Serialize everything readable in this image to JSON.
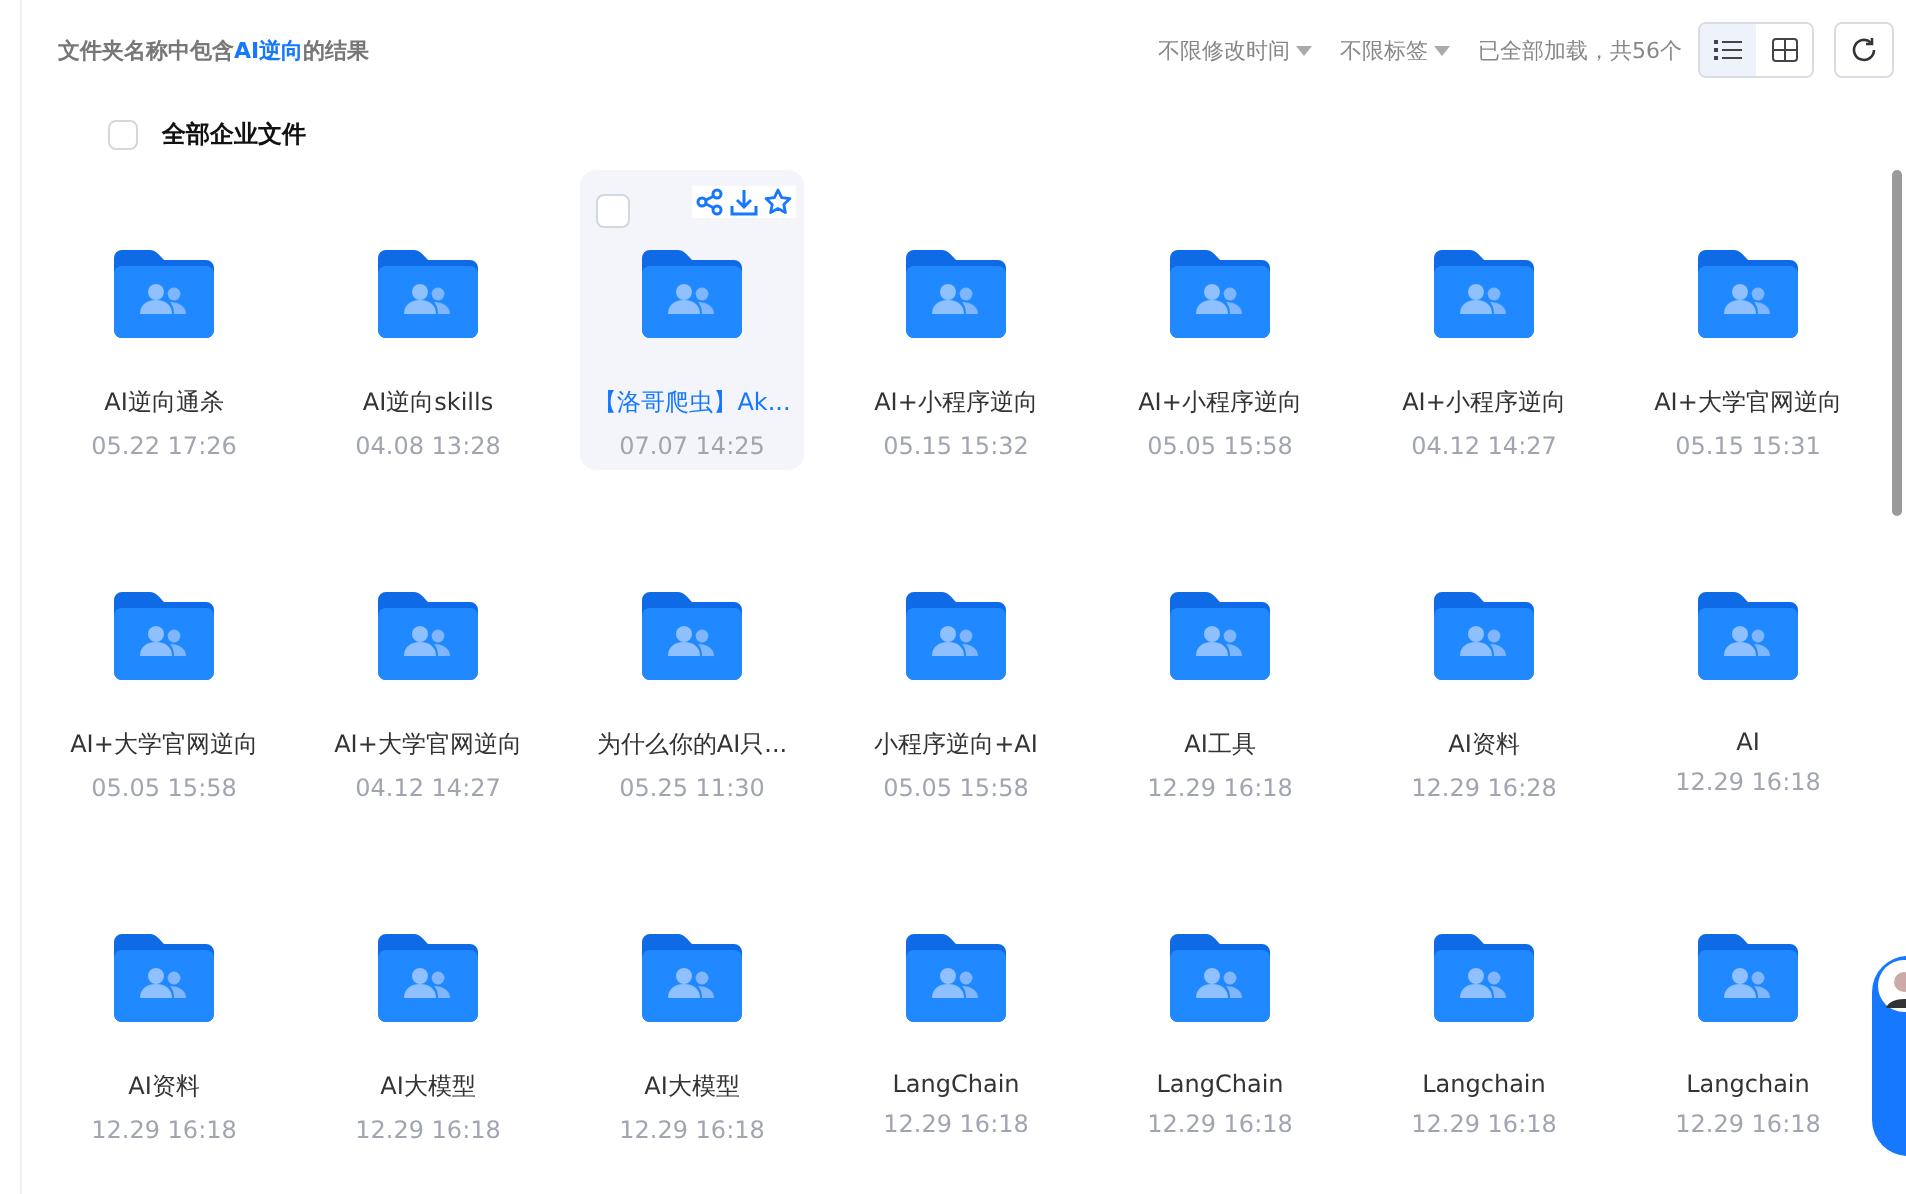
{
  "header": {
    "result_prefix": "文件夹名称中包含",
    "query": "AI逆向",
    "result_suffix": "的结果",
    "filters": [
      {
        "label": "不限修改时间"
      },
      {
        "label": "不限标签"
      }
    ],
    "status": "已全部加载，共56个",
    "views": [
      {
        "kind": "list",
        "selected": true
      },
      {
        "kind": "grid",
        "selected": false
      }
    ]
  },
  "select_all": {
    "label": "全部企业文件",
    "checked": false
  },
  "folders": [
    {
      "name": "AI逆向通杀",
      "time": "05.22 17:26",
      "hovered": false
    },
    {
      "name": "AI逆向skills",
      "time": "04.08 13:28",
      "hovered": false
    },
    {
      "name": "【洛哥爬虫】Ak...",
      "time": "07.07 14:25",
      "hovered": true
    },
    {
      "name": "AI+小程序逆向",
      "time": "05.15 15:32",
      "hovered": false
    },
    {
      "name": "AI+小程序逆向",
      "time": "05.05 15:58",
      "hovered": false
    },
    {
      "name": "AI+小程序逆向",
      "time": "04.12 14:27",
      "hovered": false
    },
    {
      "name": "AI+大学官网逆向",
      "time": "05.15 15:31",
      "hovered": false
    },
    {
      "name": "AI+大学官网逆向",
      "time": "05.05 15:58",
      "hovered": false
    },
    {
      "name": "AI+大学官网逆向",
      "time": "04.12 14:27",
      "hovered": false
    },
    {
      "name": "为什么你的AI只...",
      "time": "05.25 11:30",
      "hovered": false
    },
    {
      "name": "小程序逆向+AI",
      "time": "05.05 15:58",
      "hovered": false
    },
    {
      "name": "AI工具",
      "time": "12.29 16:18",
      "hovered": false
    },
    {
      "name": "AI资料",
      "time": "12.29 16:28",
      "hovered": false
    },
    {
      "name": "AI",
      "time": "12.29 16:18",
      "hovered": false
    },
    {
      "name": "AI资料",
      "time": "12.29 16:18",
      "hovered": false
    },
    {
      "name": "AI大模型",
      "time": "12.29 16:18",
      "hovered": false
    },
    {
      "name": "AI大模型",
      "time": "12.29 16:18",
      "hovered": false
    },
    {
      "name": "LangChain",
      "time": "12.29 16:18",
      "hovered": false
    },
    {
      "name": "LangChain",
      "time": "12.29 16:18",
      "hovered": false
    },
    {
      "name": "Langchain",
      "time": "12.29 16:18",
      "hovered": false
    },
    {
      "name": "Langchain",
      "time": "12.29 16:18",
      "hovered": false
    }
  ]
}
